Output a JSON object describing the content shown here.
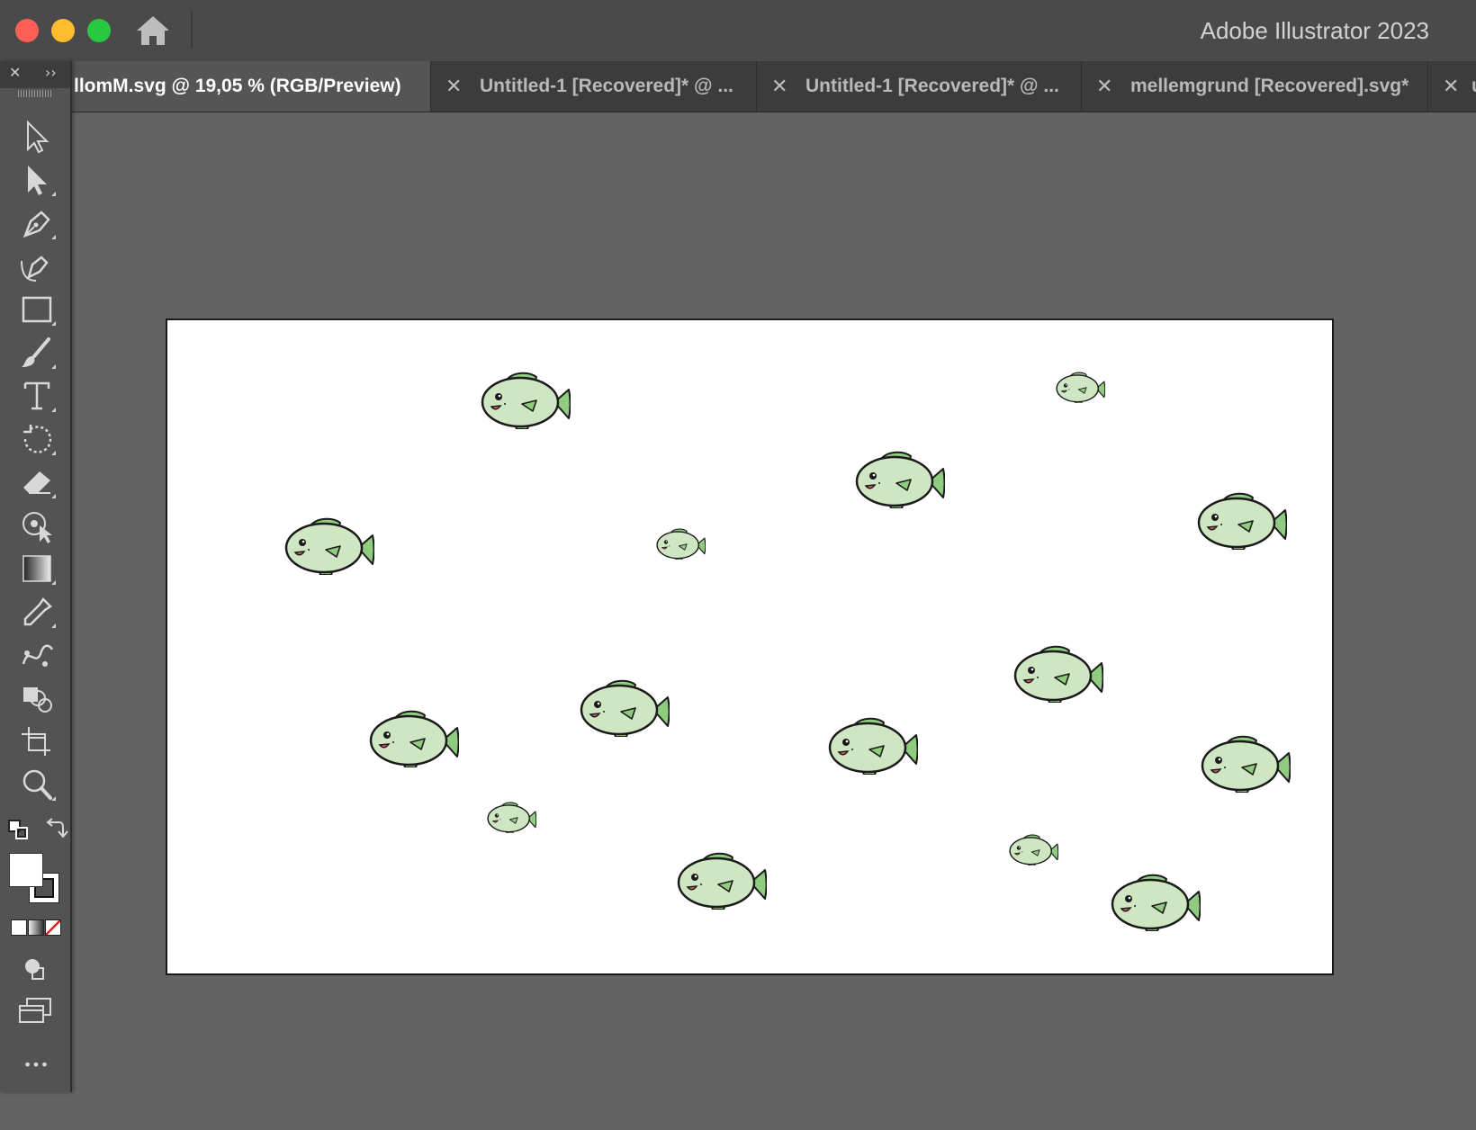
{
  "window": {
    "app_title": "Adobe Illustrator 2023",
    "controls": [
      "close",
      "minimize",
      "maximize"
    ],
    "home_icon": "home-icon"
  },
  "tabs": [
    {
      "label": "llomM.svg @ 19,05 % (RGB/Preview)",
      "active": true
    },
    {
      "label": "Untitled-1 [Recovered]* @ ...",
      "active": false
    },
    {
      "label": "Untitled-1 [Recovered]* @ ...",
      "active": false
    },
    {
      "label": "mellemgrund [Recovered].svg*",
      "active": false
    },
    {
      "label": "u",
      "active": false
    }
  ],
  "tab_close_glyph": "✕",
  "toolbar": {
    "close_glyph": "✕",
    "expand_glyph": "››",
    "tools": [
      "selection-tool-icon",
      "direct-selection-tool-icon",
      "pen-tool-icon",
      "curvature-tool-icon",
      "rectangle-tool-icon",
      "paintbrush-tool-icon",
      "type-tool-icon",
      "rotate-tool-icon",
      "eraser-tool-icon",
      "puppet-warp-tool-icon",
      "gradient-tool-icon",
      "eyedropper-tool-icon",
      "blend-tool-icon",
      "shape-builder-tool-icon",
      "artboard-tool-icon",
      "zoom-tool-icon"
    ],
    "more_glyph": "•••"
  },
  "colors": {
    "fish_body": "#cfe6c2",
    "fish_fin": "#8fcc80",
    "fish_outline": "#1a1a1a",
    "canvas_bg": "#636363",
    "artboard": "#ffffff"
  }
}
